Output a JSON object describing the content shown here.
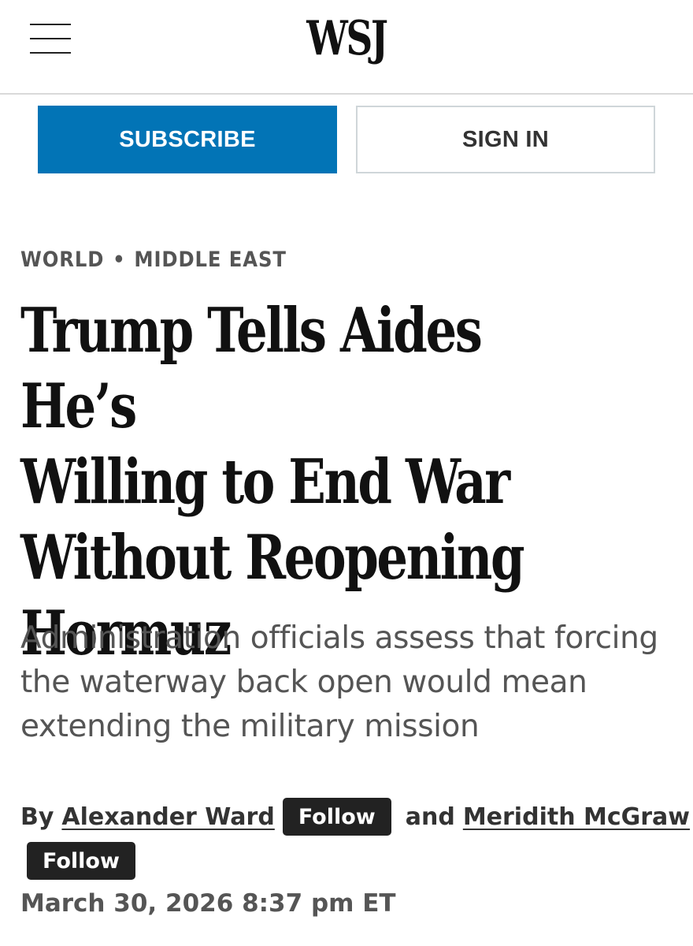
{
  "header": {
    "logo": "WSJ",
    "menu_icon": "hamburger-menu-icon"
  },
  "auth": {
    "subscribe_label": "SUBSCRIBE",
    "signin_label": "SIGN IN",
    "subscribe_color": "#0274b6"
  },
  "article": {
    "section": "WORLD",
    "section_separator": "•",
    "subsection": "MIDDLE EAST",
    "headline_lines": [
      "Trump Tells Aides He’s",
      "Willing to End War",
      "Without Reopening",
      "Hormuz"
    ],
    "dek_lines": [
      "Administration officials assess that forcing",
      "the waterway back open would mean",
      "extending the military mission"
    ],
    "byline": {
      "prefix": "By",
      "authors": [
        "Alexander Ward",
        "Meridith McGraw"
      ],
      "conjunction": "and",
      "follow_label": "Follow"
    },
    "timestamp": "March 30, 2026 8:37 pm ET"
  }
}
